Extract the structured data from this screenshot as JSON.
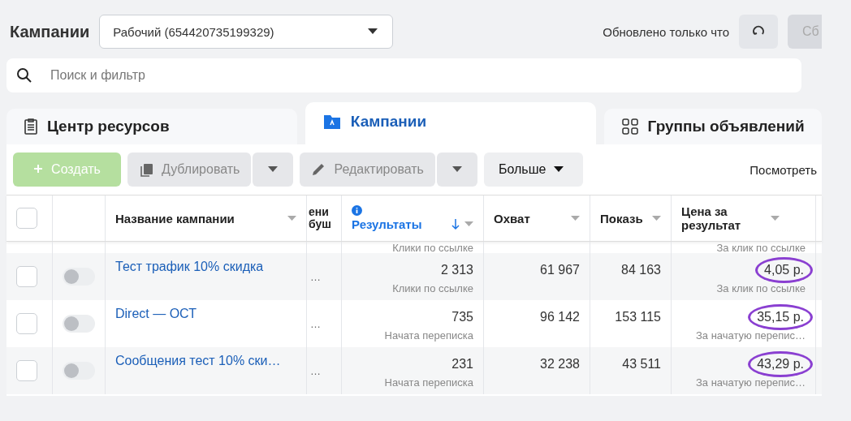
{
  "header": {
    "title": "Кампании",
    "account": "Рабочий (654420735199329)",
    "updated": "Обновлено только что",
    "cut_button": "Сб"
  },
  "search": {
    "placeholder": "Поиск и фильтр"
  },
  "tabs": [
    {
      "label": "Центр ресурсов",
      "selected": false,
      "kind": "resources"
    },
    {
      "label": "Кампании",
      "selected": true,
      "kind": "campaigns"
    },
    {
      "label": "Группы объявлений",
      "selected": false,
      "kind": "adsets"
    }
  ],
  "toolbar": {
    "buttons": [
      {
        "label": "Создать",
        "kind": "create",
        "disabled": true
      },
      {
        "label": "Дублировать",
        "kind": "duplicate",
        "disabled": true
      },
      {
        "label": "Редактировать",
        "kind": "edit",
        "disabled": true
      },
      {
        "label": "Больше",
        "kind": "more",
        "disabled": false
      }
    ],
    "view_link": "Посмотреть"
  },
  "table": {
    "select_all": {
      "checked": false
    },
    "columns": [
      {
        "label": "Название кампании",
        "sorted": false
      },
      {
        "label": "ени буш",
        "sorted": false
      },
      {
        "label": "Результаты",
        "sorted": true
      },
      {
        "label": "Охват",
        "sorted": false
      },
      {
        "label": "Показь",
        "sorted": false
      },
      {
        "label": "Цена за результат",
        "sorted": false
      }
    ],
    "partial_row": {
      "result_label": "Клики по ссылке",
      "cost_label": "За клик по ссылке"
    },
    "rows": [
      {
        "checked": false,
        "on": false,
        "name": "Тест трафик 10% скидка",
        "column_2": "…",
        "results": "2 313",
        "result_label": "Клики по ссылке",
        "reach": "61 967",
        "impressions": "84 163",
        "cost": "4,05 р.",
        "cost_label": "За клик по ссылке",
        "highlighted": true
      },
      {
        "checked": false,
        "on": false,
        "name": "Direct — ОСТ",
        "column_2": "…",
        "results": "735",
        "result_label": "Начата переписка",
        "reach": "96 142",
        "impressions": "153 115",
        "cost": "35,15 р.",
        "cost_label": "За начатую перепис…",
        "highlighted": true
      },
      {
        "checked": false,
        "on": false,
        "name": "Сообщения тест 10% ски…",
        "column_2": "…",
        "results": "231",
        "result_label": "Начата переписка",
        "reach": "32 238",
        "impressions": "43 511",
        "cost": "43,29 р.",
        "cost_label": "За начатую перепис…",
        "highlighted": true
      }
    ]
  }
}
